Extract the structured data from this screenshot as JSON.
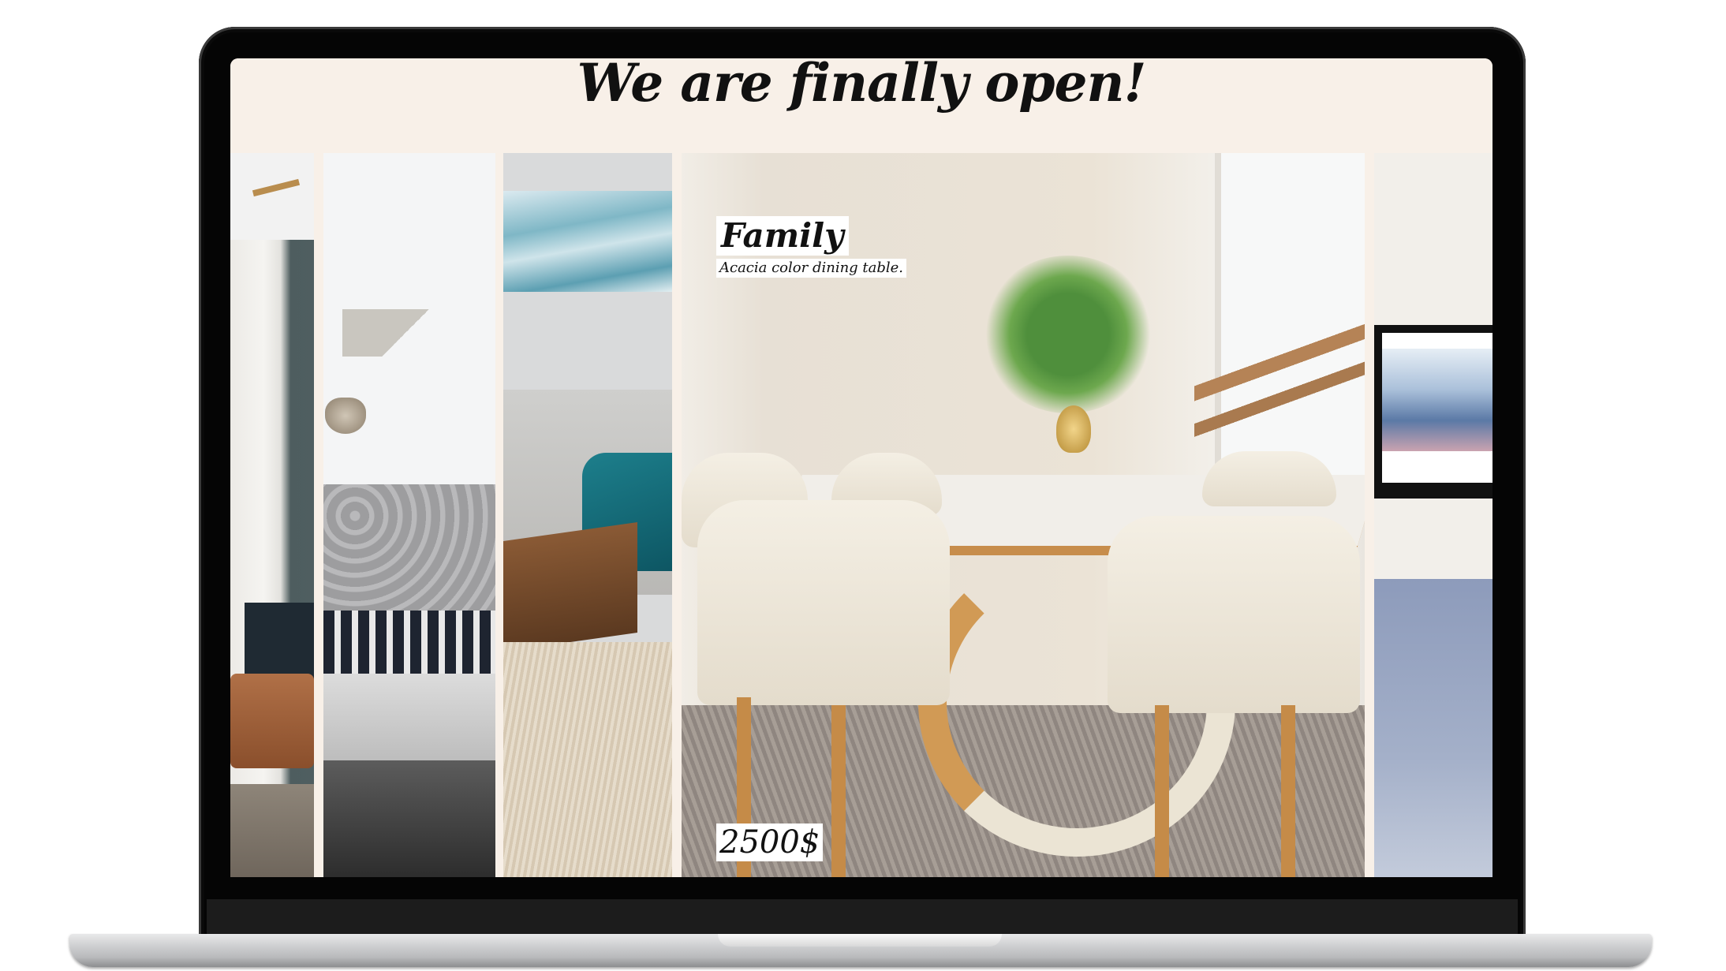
{
  "page": {
    "headline": "We are finally open!"
  },
  "featured": {
    "title": "Family",
    "description": "Acacia color dining table.",
    "price": "2500$"
  },
  "colors": {
    "background": "#f8f0e8",
    "laptop_frame": "#050505",
    "text": "#111111"
  }
}
